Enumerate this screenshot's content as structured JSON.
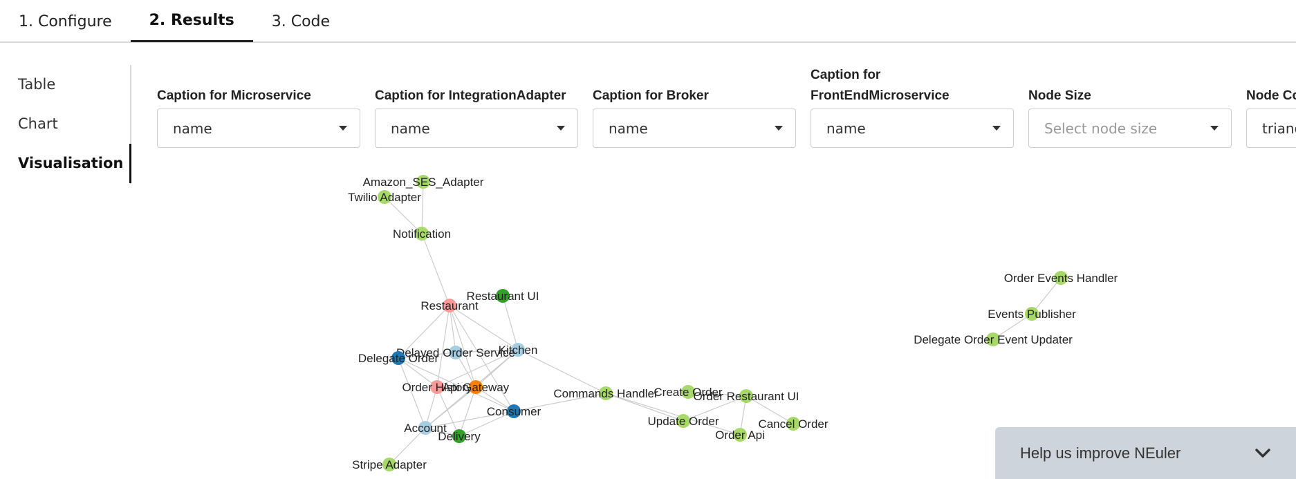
{
  "tabs": [
    {
      "label": "1. Configure"
    },
    {
      "label": "2. Results"
    },
    {
      "label": "3. Code"
    }
  ],
  "side_nav": [
    {
      "label": "Table"
    },
    {
      "label": "Chart"
    },
    {
      "label": "Visualisation"
    }
  ],
  "controls": [
    {
      "label": "Caption for Microservice",
      "value": "name"
    },
    {
      "label": "Caption for IntegrationAdapter",
      "value": "name"
    },
    {
      "label": "Caption for Broker",
      "value": "name"
    },
    {
      "label": "Caption for FrontEndMicroservice",
      "value": "name"
    },
    {
      "label": "Node Size",
      "placeholder": "Select node size"
    },
    {
      "label": "Node Co",
      "value": "triang"
    }
  ],
  "colors": {
    "light_green": "#a6d96a",
    "dark_green": "#33a02c",
    "light_blue": "#a6cee3",
    "dark_blue": "#1f78b4",
    "pink": "#fb9a99",
    "orange": "#ff7f00",
    "edge": "#cccccc"
  },
  "graph": {
    "nodes": [
      {
        "id": "amazon",
        "label": "Amazon_SES_Adapter",
        "color": "light_green"
      },
      {
        "id": "twilio",
        "label": "Twilio Adapter",
        "color": "light_green"
      },
      {
        "id": "notification",
        "label": "Notification",
        "color": "light_green"
      },
      {
        "id": "restaurant",
        "label": "Restaurant",
        "color": "pink"
      },
      {
        "id": "restaurant_ui",
        "label": "Restaurant UI",
        "color": "dark_green"
      },
      {
        "id": "kitchen",
        "label": "Kitchen",
        "color": "light_blue"
      },
      {
        "id": "delayed",
        "label": "Delayed Order Service",
        "color": "light_blue"
      },
      {
        "id": "delegate",
        "label": "Delegate Order",
        "color": "dark_blue"
      },
      {
        "id": "order_history",
        "label": "Order History",
        "color": "pink"
      },
      {
        "id": "api_gateway",
        "label": "Api Gateway",
        "color": "orange"
      },
      {
        "id": "consumer",
        "label": "Consumer",
        "color": "dark_blue"
      },
      {
        "id": "account",
        "label": "Account",
        "color": "light_blue"
      },
      {
        "id": "delivery",
        "label": "Delivery",
        "color": "dark_green"
      },
      {
        "id": "stripe",
        "label": "Stripe Adapter",
        "color": "light_green"
      },
      {
        "id": "commands",
        "label": "Commands Handler",
        "color": "light_green"
      },
      {
        "id": "create_order",
        "label": "Create Order",
        "color": "light_green"
      },
      {
        "id": "order_restaurant_ui",
        "label": "Order Restaurant UI",
        "color": "light_green"
      },
      {
        "id": "update_order",
        "label": "Update Order",
        "color": "light_green"
      },
      {
        "id": "order_api",
        "label": "Order Api",
        "color": "light_green"
      },
      {
        "id": "cancel_order",
        "label": "Cancel Order",
        "color": "light_green"
      },
      {
        "id": "order_events",
        "label": "Order Events Handler",
        "color": "light_green"
      },
      {
        "id": "events_publisher",
        "label": "Events Publisher",
        "color": "light_green"
      },
      {
        "id": "delegate_updater",
        "label": "Delegate Order Event Updater",
        "color": "light_green"
      }
    ],
    "edges": [
      [
        "amazon",
        "notification"
      ],
      [
        "twilio",
        "notification"
      ],
      [
        "notification",
        "restaurant"
      ],
      [
        "restaurant",
        "delayed"
      ],
      [
        "restaurant",
        "kitchen"
      ],
      [
        "restaurant",
        "delegate"
      ],
      [
        "restaurant",
        "order_history"
      ],
      [
        "restaurant",
        "api_gateway"
      ],
      [
        "restaurant",
        "consumer"
      ],
      [
        "restaurant_ui",
        "kitchen"
      ],
      [
        "kitchen",
        "delayed"
      ],
      [
        "kitchen",
        "order_history"
      ],
      [
        "kitchen",
        "api_gateway"
      ],
      [
        "kitchen",
        "account"
      ],
      [
        "kitchen",
        "commands"
      ],
      [
        "delayed",
        "delegate"
      ],
      [
        "delayed",
        "api_gateway"
      ],
      [
        "delegate",
        "order_history"
      ],
      [
        "delegate",
        "account"
      ],
      [
        "delegate",
        "consumer"
      ],
      [
        "order_history",
        "api_gateway"
      ],
      [
        "order_history",
        "account"
      ],
      [
        "order_history",
        "delivery"
      ],
      [
        "api_gateway",
        "consumer"
      ],
      [
        "api_gateway",
        "delivery"
      ],
      [
        "api_gateway",
        "account"
      ],
      [
        "consumer",
        "account"
      ],
      [
        "consumer",
        "delivery"
      ],
      [
        "consumer",
        "commands"
      ],
      [
        "account",
        "delivery"
      ],
      [
        "account",
        "stripe"
      ],
      [
        "commands",
        "update_order"
      ],
      [
        "commands",
        "order_api"
      ],
      [
        "create_order",
        "order_restaurant_ui"
      ],
      [
        "update_order",
        "order_restaurant_ui"
      ],
      [
        "order_restaurant_ui",
        "cancel_order"
      ],
      [
        "order_restaurant_ui",
        "order_api"
      ],
      [
        "order_events",
        "events_publisher"
      ],
      [
        "events_publisher",
        "delegate_updater"
      ]
    ]
  },
  "feedback": {
    "label": "Help us improve NEuler"
  }
}
